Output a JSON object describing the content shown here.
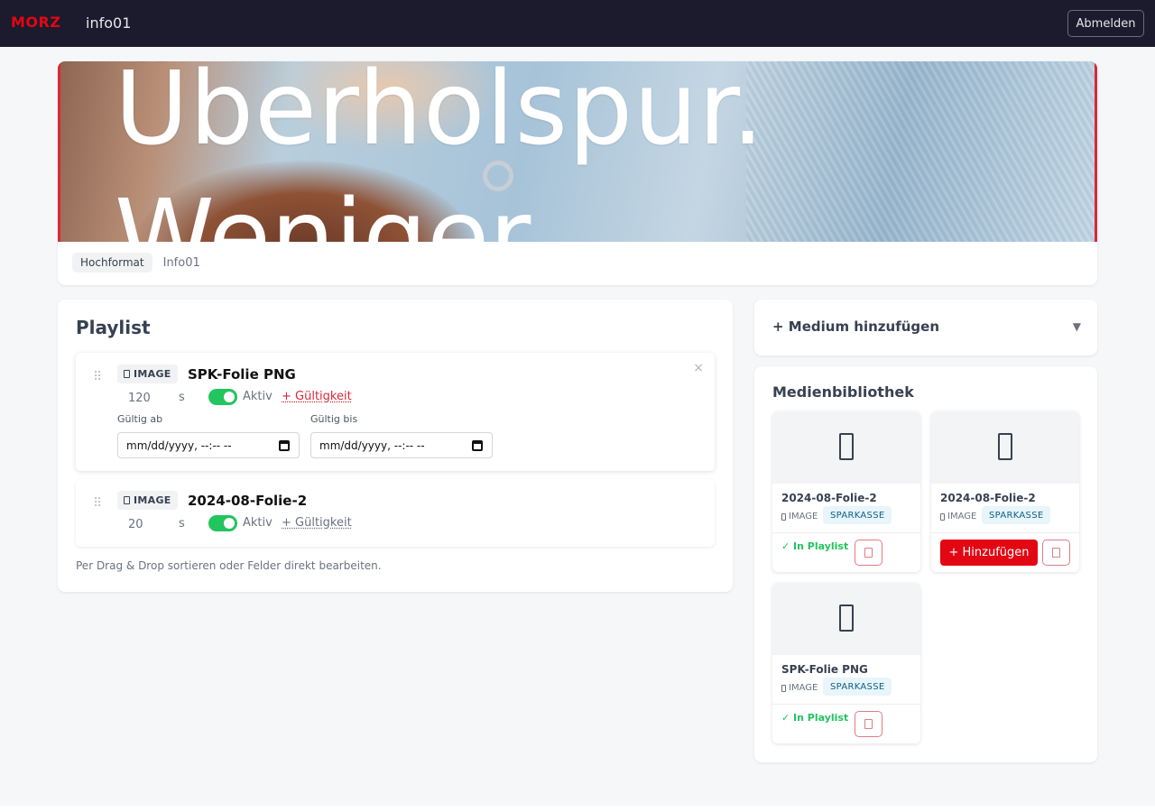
{
  "topbar": {
    "logo": "MORZ",
    "screen_name": "info01",
    "logout_label": "Abmelden"
  },
  "preview": {
    "text_line1": "Überholspur.",
    "text_line2": "Weniger",
    "tags": [
      "Hochformat",
      "Info01"
    ]
  },
  "playlist": {
    "title": "Playlist",
    "items": [
      {
        "type": "IMAGE",
        "title": "SPK-Folie PNG",
        "duration": "120",
        "unit": "s",
        "active_label": "Aktiv",
        "validity_link": "+ Gültigkeit",
        "valid_from_label": "Gültig ab",
        "valid_to_label": "Gültig bis",
        "valid_from": "mm/dd/yyyy, --:-- --",
        "valid_to": "mm/dd/yyyy, --:-- --",
        "close": "×"
      },
      {
        "type": "IMAGE",
        "title": "2024-08-Folie-2",
        "duration": "20",
        "unit": "s",
        "active_label": "Aktiv",
        "validity_link": "+ Gültigkeit"
      }
    ],
    "hint": "Per Drag & Drop sortieren oder Felder direkt bearbeiten."
  },
  "add_medium": {
    "title": "+ Medium hinzufügen",
    "caret": "▼"
  },
  "library": {
    "title": "Medienbibliothek",
    "tiles": [
      {
        "name": "2024-08-Folie-2",
        "type": "IMAGE",
        "tag": "SPARKASSE",
        "status": "✓ In Playlist"
      },
      {
        "name": "2024-08-Folie-2",
        "type": "IMAGE",
        "tag": "SPARKASSE",
        "action": "+ Hinzufügen"
      },
      {
        "name": "SPK-Folie PNG",
        "type": "IMAGE",
        "tag": "SPARKASSE",
        "status": "✓ In Playlist"
      }
    ]
  },
  "colors": {
    "brand": "#e30613",
    "topbar": "#1b1b2d",
    "active_toggle": "#22c55e",
    "tag_bg": "#e8f5fb"
  }
}
